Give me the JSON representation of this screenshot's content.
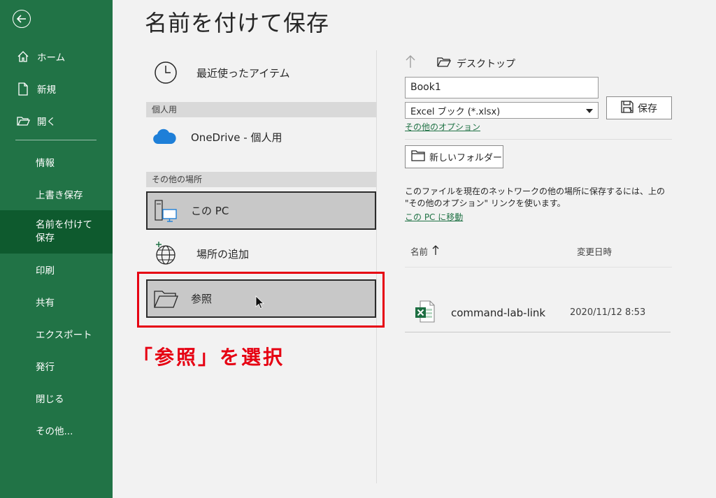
{
  "title": "名前を付けて保存",
  "sidebar": {
    "top_items": [
      {
        "label": "ホーム",
        "icon": "home-icon"
      },
      {
        "label": "新規",
        "icon": "new-document-icon"
      },
      {
        "label": "開く",
        "icon": "open-folder-icon"
      }
    ],
    "bottom_items": [
      {
        "label": "情報"
      },
      {
        "label": "上書き保存"
      },
      {
        "label": "名前を付けて保存",
        "selected": true
      },
      {
        "label": "印刷"
      },
      {
        "label": "共有"
      },
      {
        "label": "エクスポート"
      },
      {
        "label": "発行"
      },
      {
        "label": "閉じる"
      },
      {
        "label": "その他..."
      }
    ]
  },
  "locations": {
    "recent_label": "最近使ったアイテム",
    "personal_group": "個人用",
    "onedrive_label": "OneDrive - 個人用",
    "other_group": "その他の場所",
    "this_pc_label": "この PC",
    "add_place_label": "場所の追加",
    "browse_label": "参照"
  },
  "annotation": "「参照」を選択",
  "right": {
    "path": "デスクトップ",
    "filename_value": "Book1",
    "filetype_value": "Excel ブック (*.xlsx)",
    "save_label": "保存",
    "options_link": "その他のオプション",
    "new_folder_label": "新しいフォルダー",
    "info_text": "このファイルを現在のネットワークの他の場所に保存するには、上の \"その他のオプション\" リンクを使います。",
    "info_link": "この PC に移動",
    "col_name": "名前",
    "col_date": "変更日時",
    "files": [
      {
        "name": "command-lab-link",
        "date": "2020/11/12 8:53"
      }
    ]
  },
  "colors": {
    "sidebar": "#217346",
    "sidebar_selected": "#0e5a2e",
    "link": "#217346",
    "highlight": "#e60012"
  }
}
